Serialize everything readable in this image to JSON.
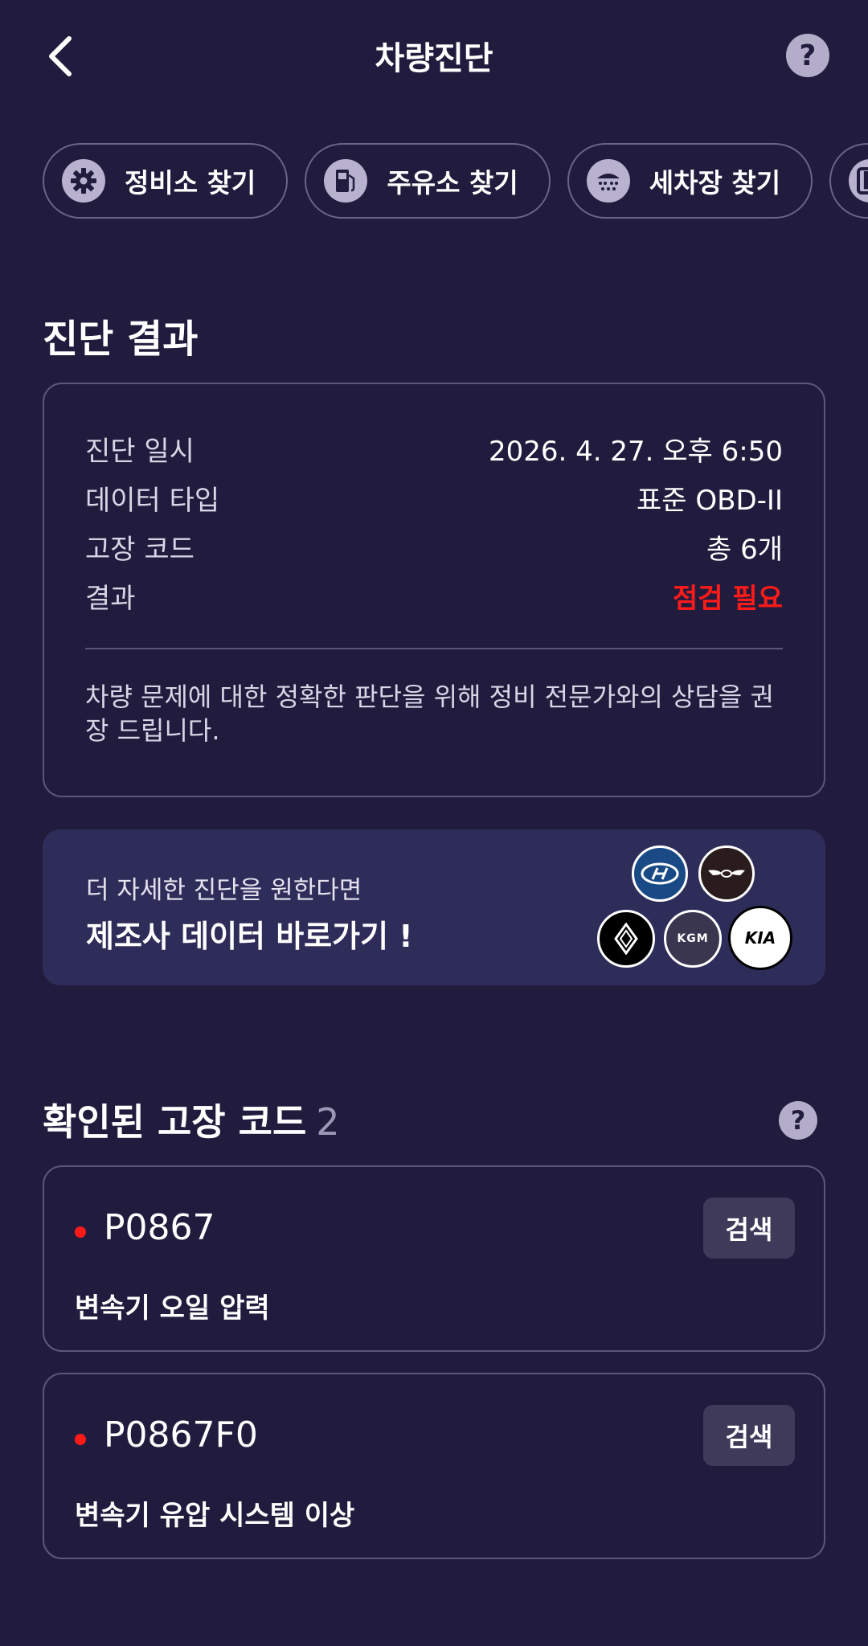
{
  "header": {
    "title": "차량진단",
    "help_label": "?"
  },
  "chips": [
    {
      "label": "정비소 찾기",
      "icon": "gear-icon"
    },
    {
      "label": "주유소 찾기",
      "icon": "fuel-pump-icon"
    },
    {
      "label": "세차장 찾기",
      "icon": "car-wash-icon"
    },
    {
      "label": "P",
      "icon": "parking-icon"
    }
  ],
  "result": {
    "section_title": "진단 결과",
    "rows": [
      {
        "key": "진단 일시",
        "value": "2026. 4. 27. 오후 6:50"
      },
      {
        "key": "데이터 타입",
        "value": "표준 OBD-II"
      },
      {
        "key": "고장 코드",
        "value": "총 6개"
      },
      {
        "key": "결과",
        "value": "점검 필요"
      }
    ],
    "note": "차량 문제에 대한 정확한 판단을 위해 정비 전문가와의 상담을 권장 드립니다.",
    "alert_color": "#ff1a1a"
  },
  "maker_banner": {
    "subtitle": "더 자세한 진단을 원한다면",
    "title": "제조사 데이터 바로가기 !",
    "logos": [
      "hyundai-logo-icon",
      "genesis-logo-icon",
      "renault-logo-icon",
      "kgm-logo-icon",
      "kia-logo-icon"
    ],
    "kgm_text": "KGM",
    "kia_text": "KIA"
  },
  "fault_codes": {
    "title": "확인된 고장 코드",
    "count": "2",
    "help_label": "?",
    "items": [
      {
        "code": "P0867",
        "desc": "변속기 오일 압력",
        "button": "검색"
      },
      {
        "code": "P0867F0",
        "desc": "변속기 유압 시스템 이상",
        "button": "검색"
      }
    ]
  },
  "colors": {
    "background": "#211c3d",
    "card_border": "#5c5678",
    "banner_bg": "#2e2d59",
    "button_bg": "#3f3a5a"
  }
}
